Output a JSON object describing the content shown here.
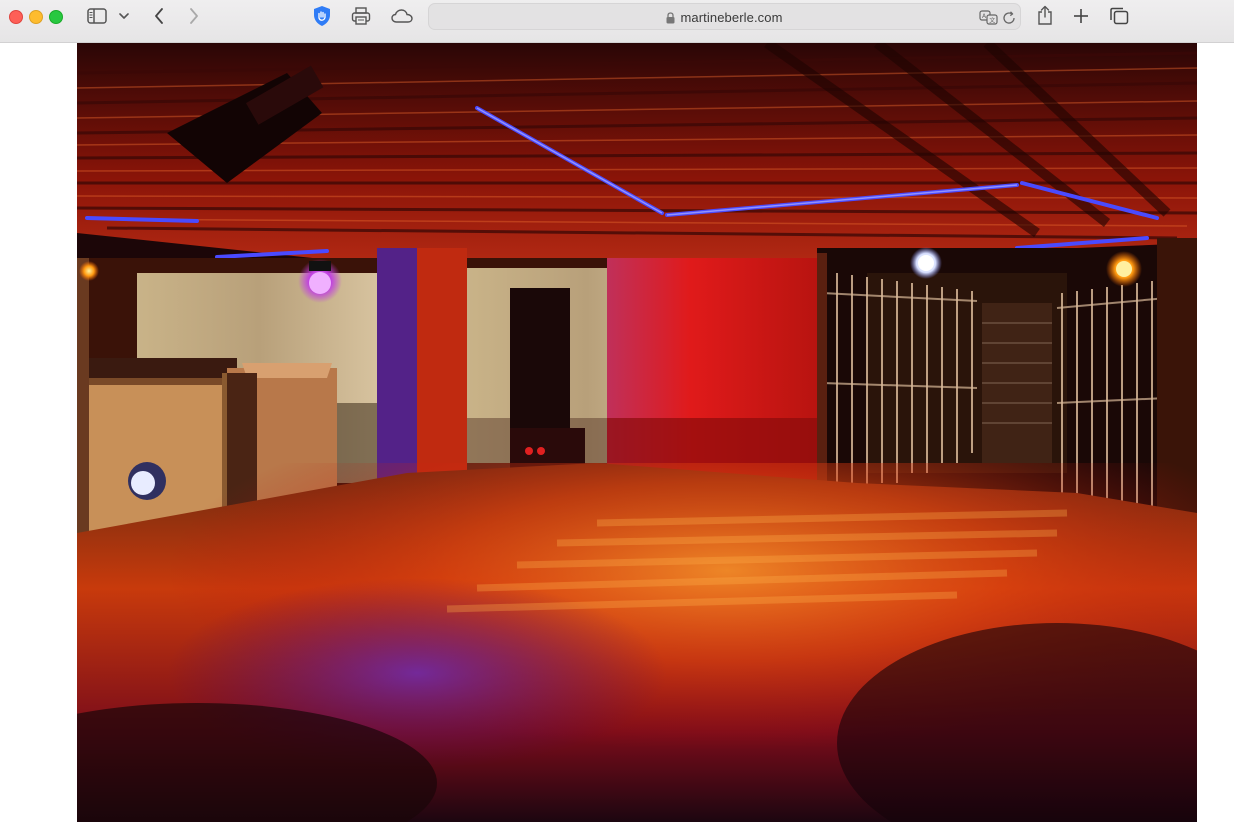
{
  "browser": {
    "url": "martineberle.com"
  },
  "icons": {
    "sidebar": "sidebar-icon",
    "tab_group_menu": "chevron-down-icon",
    "back": "back-icon",
    "forward": "forward-icon",
    "privacy": "privacy-shield-icon",
    "reader": "print-icon",
    "cloud": "cloud-icon",
    "translate": "translate-icon",
    "reload": "reload-icon",
    "share": "share-icon",
    "new_tab": "plus-icon",
    "tabs_overview": "tabs-overview-icon"
  },
  "photo": {
    "subject": "nightclub-interior-photo",
    "colors": {
      "red": "#c41410",
      "orange": "#e56a10",
      "purple": "#6a1a8a",
      "blue": "#3a3aff"
    }
  }
}
